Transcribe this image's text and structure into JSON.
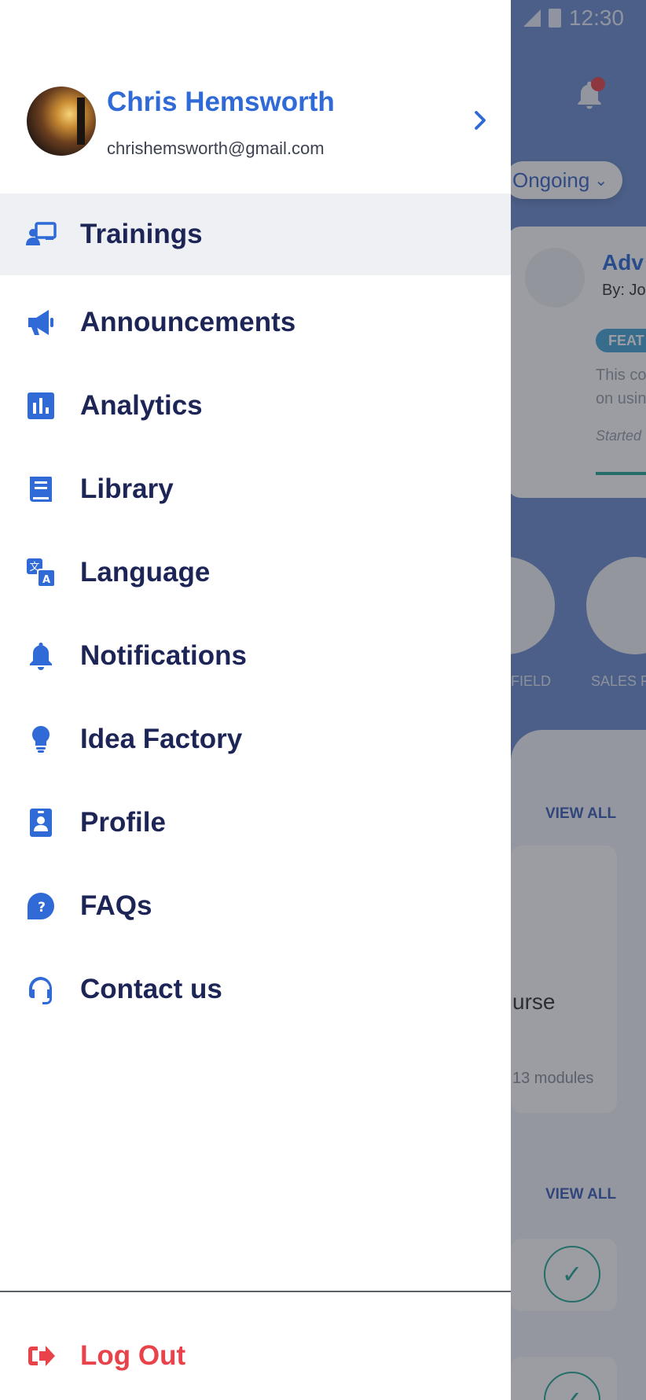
{
  "status_bar": {
    "time": "12:30"
  },
  "colors": {
    "accent": "#2f6ad6",
    "menu_text": "#1d2557",
    "logout": "#e8424a",
    "active_bg": "#eef0f4"
  },
  "background": {
    "filter": "Ongoing",
    "card": {
      "title": "Adv",
      "by": "By: Jo",
      "badge": "FEAT",
      "desc_line1": "This co",
      "desc_line2": "on usin",
      "started": "Started"
    },
    "categories": [
      "FIELD",
      "SALES F"
    ],
    "view_all_1": "VIEW ALL",
    "course_text": "urse",
    "modules": "13 modules",
    "view_all_2": "VIEW ALL"
  },
  "profile": {
    "name": "Chris Hemsworth",
    "email": "chrishemsworth@gmail.com"
  },
  "menu": [
    {
      "label": "Trainings",
      "icon": "trainings-icon"
    },
    {
      "label": "Announcements",
      "icon": "megaphone-icon"
    },
    {
      "label": "Analytics",
      "icon": "analytics-icon"
    },
    {
      "label": "Library",
      "icon": "book-icon"
    },
    {
      "label": "Language",
      "icon": "translate-icon"
    },
    {
      "label": "Notifications",
      "icon": "bell-icon"
    },
    {
      "label": "Idea Factory",
      "icon": "lightbulb-icon"
    },
    {
      "label": "Profile",
      "icon": "id-badge-icon"
    },
    {
      "label": "FAQs",
      "icon": "question-icon"
    },
    {
      "label": "Contact us",
      "icon": "headset-icon"
    }
  ],
  "logout": {
    "label": "Log Out",
    "icon": "logout-icon"
  }
}
